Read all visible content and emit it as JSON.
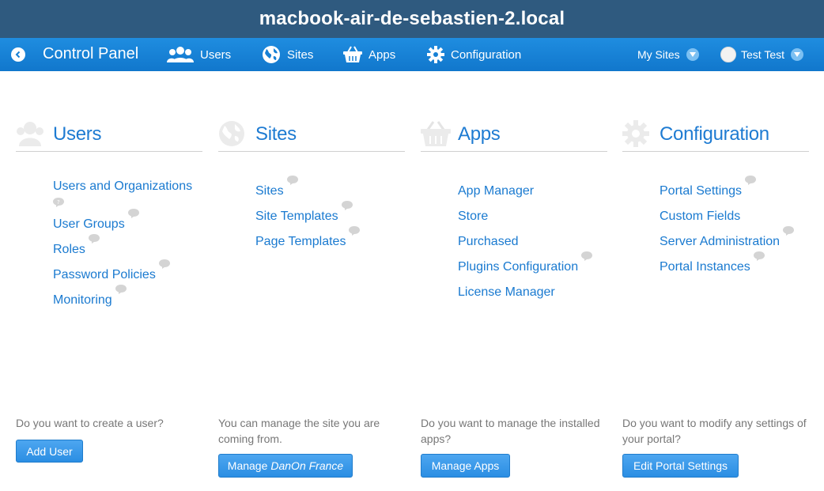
{
  "window": {
    "title": "macbook-air-de-sebastien-2.local"
  },
  "navbar": {
    "title": "Control Panel",
    "items": [
      {
        "label": "Users",
        "icon": "users-icon"
      },
      {
        "label": "Sites",
        "icon": "globe-icon"
      },
      {
        "label": "Apps",
        "icon": "basket-icon"
      },
      {
        "label": "Configuration",
        "icon": "gear-icon"
      }
    ],
    "my_sites": "My Sites",
    "user_name": "Test Test"
  },
  "columns": [
    {
      "title": "Users",
      "icon": "users-icon",
      "links": [
        "Users and Organizations",
        "User Groups",
        "Roles",
        "Password Policies",
        "Monitoring"
      ],
      "footer_text": "Do you want to create a user?",
      "button": "Add User"
    },
    {
      "title": "Sites",
      "icon": "globe-icon",
      "links": [
        "Sites",
        "Site Templates",
        "Page Templates"
      ],
      "footer_text": "You can manage the site you are coming from.",
      "button_prefix": "Manage",
      "button_site": "DanOn France"
    },
    {
      "title": "Apps",
      "icon": "basket-icon",
      "links": [
        "App Manager",
        "Store",
        "Purchased",
        "Plugins Configuration",
        "License Manager"
      ],
      "footer_text": "Do you want to manage the installed apps?",
      "button": "Manage Apps"
    },
    {
      "title": "Configuration",
      "icon": "gear-icon",
      "links": [
        "Portal Settings",
        "Custom Fields",
        "Server Administration",
        "Portal Instances"
      ],
      "footer_text": "Do you want to modify any settings of your portal?",
      "button": "Edit Portal Settings"
    }
  ],
  "colors": {
    "titlebar": "#2f5a7f",
    "navbar": "#1680d5",
    "link": "#1a7ad0",
    "heading": "#1e7bd2"
  }
}
